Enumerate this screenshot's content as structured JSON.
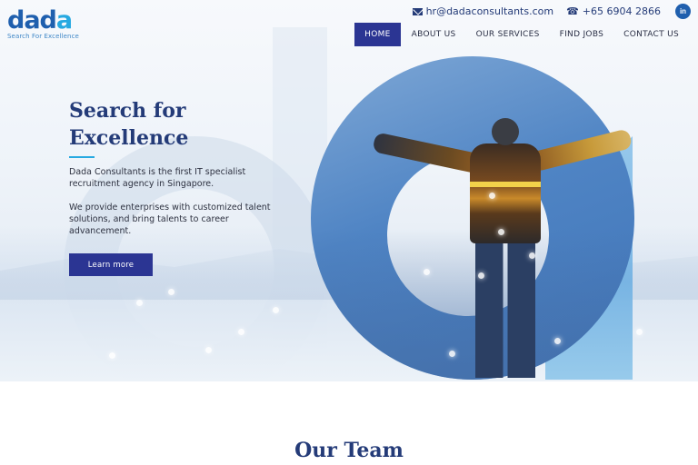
{
  "brand": {
    "logo_main": "dad",
    "logo_accent": "a",
    "tagline": "Search For Excellence",
    "primary_color": "#2b3593",
    "accent_color": "#27a9e1"
  },
  "contact": {
    "email": "hr@dadaconsultants.com",
    "phone": "+65 6904 2866",
    "social": "in"
  },
  "nav": {
    "items": [
      {
        "label": "HOME",
        "active": true
      },
      {
        "label": "ABOUT US"
      },
      {
        "label": "OUR SERVICES"
      },
      {
        "label": "FIND JOBS"
      },
      {
        "label": "CONTACT US"
      }
    ]
  },
  "hero": {
    "title": "Search for Excellence",
    "paragraph1": "Dada Consultants is the first IT specialist recruitment agency in Singapore.",
    "paragraph2": "We provide enterprises with customized talent solutions, and bring talents to career advancement.",
    "button": "Learn more"
  },
  "team": {
    "title": "Our Team"
  }
}
